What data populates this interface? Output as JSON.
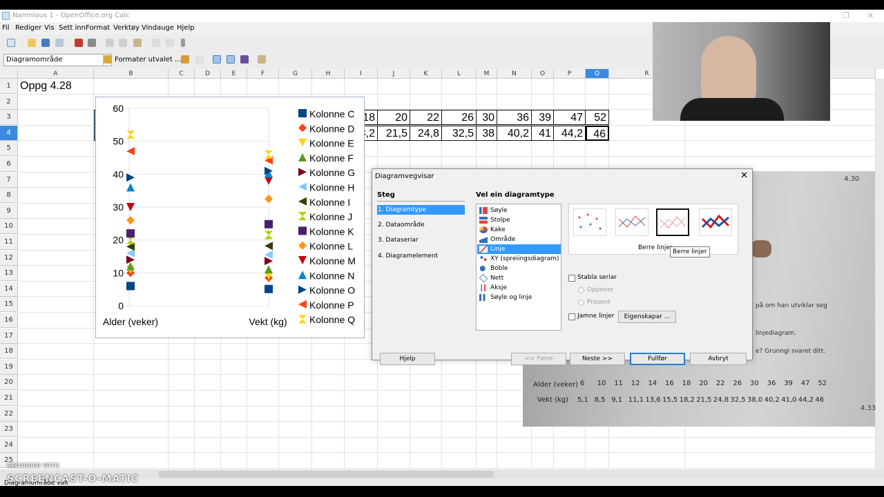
{
  "window": {
    "title": "Namnlaus 1 - OpenOffice.org Calc"
  },
  "menu": [
    "Fil",
    "Rediger",
    "Vis",
    "Sett inn",
    "Format",
    "Verktøy",
    "Vindauge",
    "Hjelp"
  ],
  "toolbar": {
    "namebox": "Diagramområde",
    "format_label": "Formater utvalet ..."
  },
  "columns": [
    "A",
    "B",
    "C",
    "D",
    "E",
    "F",
    "G",
    "H",
    "I",
    "J",
    "K",
    "L",
    "M",
    "N",
    "O",
    "P",
    "Q",
    "R",
    "U"
  ],
  "rows": [
    "1",
    "2",
    "3",
    "4",
    "5",
    "6",
    "7",
    "8",
    "9",
    "10",
    "11",
    "12",
    "13",
    "14",
    "15",
    "16",
    "17",
    "18",
    "19",
    "20",
    "21",
    "22",
    "23",
    "24",
    "25"
  ],
  "sheet": {
    "title_cell": "Oppg 4.28",
    "row3_label": "Alder (veker)",
    "row3_values": [
      "6",
      "10",
      "11",
      "12",
      "14",
      "16",
      "18",
      "20",
      "22",
      "26",
      "30",
      "36",
      "39",
      "47",
      "52"
    ],
    "row4_label": "Vekt (kg)",
    "row4_values": [
      "5,1",
      "8,5",
      "9,1",
      "11,1",
      "13,6",
      "15,5",
      "18,2",
      "21,5",
      "24,8",
      "32,5",
      "38",
      "40,2",
      "41",
      "44,2",
      "46"
    ]
  },
  "chart_data": {
    "type": "line",
    "categories": [
      "Alder (veker)",
      "Vekt (kg)"
    ],
    "ylim": [
      0,
      60
    ],
    "yticks": [
      "0",
      "10",
      "20",
      "30",
      "40",
      "50",
      "60"
    ],
    "legend_position": "right",
    "series": [
      {
        "name": "Kolonne C",
        "values": [
          6,
          5.1
        ],
        "color": "#004586",
        "marker": "square"
      },
      {
        "name": "Kolonne D",
        "values": [
          10,
          8.5
        ],
        "color": "#ff420e",
        "marker": "diamond"
      },
      {
        "name": "Kolonne E",
        "values": [
          11,
          9.1
        ],
        "color": "#ffd320",
        "marker": "triangle-down"
      },
      {
        "name": "Kolonne F",
        "values": [
          12,
          11.1
        ],
        "color": "#579d1c",
        "marker": "triangle-up"
      },
      {
        "name": "Kolonne G",
        "values": [
          14,
          13.6
        ],
        "color": "#7e0021",
        "marker": "triangle-right"
      },
      {
        "name": "Kolonne H",
        "values": [
          16,
          15.5
        ],
        "color": "#83caff",
        "marker": "triangle-left"
      },
      {
        "name": "Kolonne I",
        "values": [
          18,
          18.2
        ],
        "color": "#314004",
        "marker": "triangle-left"
      },
      {
        "name": "Kolonne J",
        "values": [
          20,
          21.5
        ],
        "color": "#aecf00",
        "marker": "hourglass"
      },
      {
        "name": "Kolonne K",
        "values": [
          22,
          24.8
        ],
        "color": "#4b1f6f",
        "marker": "square"
      },
      {
        "name": "Kolonne L",
        "values": [
          26,
          32.5
        ],
        "color": "#ff950e",
        "marker": "diamond"
      },
      {
        "name": "Kolonne M",
        "values": [
          30,
          38
        ],
        "color": "#c5000b",
        "marker": "triangle-down"
      },
      {
        "name": "Kolonne N",
        "values": [
          36,
          40.2
        ],
        "color": "#0084d1",
        "marker": "triangle-up"
      },
      {
        "name": "Kolonne O",
        "values": [
          39,
          41
        ],
        "color": "#004586",
        "marker": "triangle-right"
      },
      {
        "name": "Kolonne P",
        "values": [
          47,
          44.2
        ],
        "color": "#ff420e",
        "marker": "triangle-left"
      },
      {
        "name": "Kolonne Q",
        "values": [
          52,
          46
        ],
        "color": "#ffd320",
        "marker": "hourglass"
      }
    ]
  },
  "dialog": {
    "title": "Diagramvegvisar",
    "steps_title": "Steg",
    "steps": [
      "1. Diagramtype",
      "2. Dataområde",
      "3. Dataseriar",
      "4. Diagramelement"
    ],
    "type_title": "Vel ein diagramtype",
    "types": [
      "Søyle",
      "Stolpe",
      "Kake",
      "Område",
      "Linje",
      "XY (spreiingsdiagram)",
      "Boble",
      "Nett",
      "Aksje",
      "Søyle og linje"
    ],
    "variant_caption": "Berre linjer",
    "tooltip": "Berre linjer",
    "stack_label": "Stabla seriar",
    "stack_options": [
      "Oppover",
      "Prosent"
    ],
    "smooth_label": "Jamne linjer",
    "properties_button": "Eigenskapar ...",
    "buttons": {
      "help": "Hjelp",
      "back": "<< Førre",
      "next": "Neste >>",
      "finish": "Fullfør",
      "cancel": "Avbryt"
    }
  },
  "photo": {
    "corner_label": "4.30",
    "corner_label2": "4.33",
    "text_lines": [
      "på om han utviklar seg",
      "linjediagram.",
      "e? Grunngi svaret ditt."
    ],
    "table_head": "Alder (veker)",
    "table_head2": "Vekt (kg)",
    "table_row1": [
      "6",
      "10",
      "11",
      "12",
      "14",
      "16",
      "18",
      "20",
      "22",
      "26",
      "30",
      "36",
      "39",
      "47",
      "52"
    ],
    "table_row2": [
      "5,1",
      "8,5",
      "9,1",
      "11,1",
      "13,6",
      "15,5",
      "18,2",
      "21,5",
      "24,8",
      "32,5",
      "38,0",
      "40,2",
      "41,0",
      "44,2",
      "46"
    ]
  },
  "status": {
    "text": "Diagramområde valt"
  },
  "watermark": {
    "line1": "RECORDED WITH",
    "line2": "SCREENCAST-O-MATIC"
  }
}
